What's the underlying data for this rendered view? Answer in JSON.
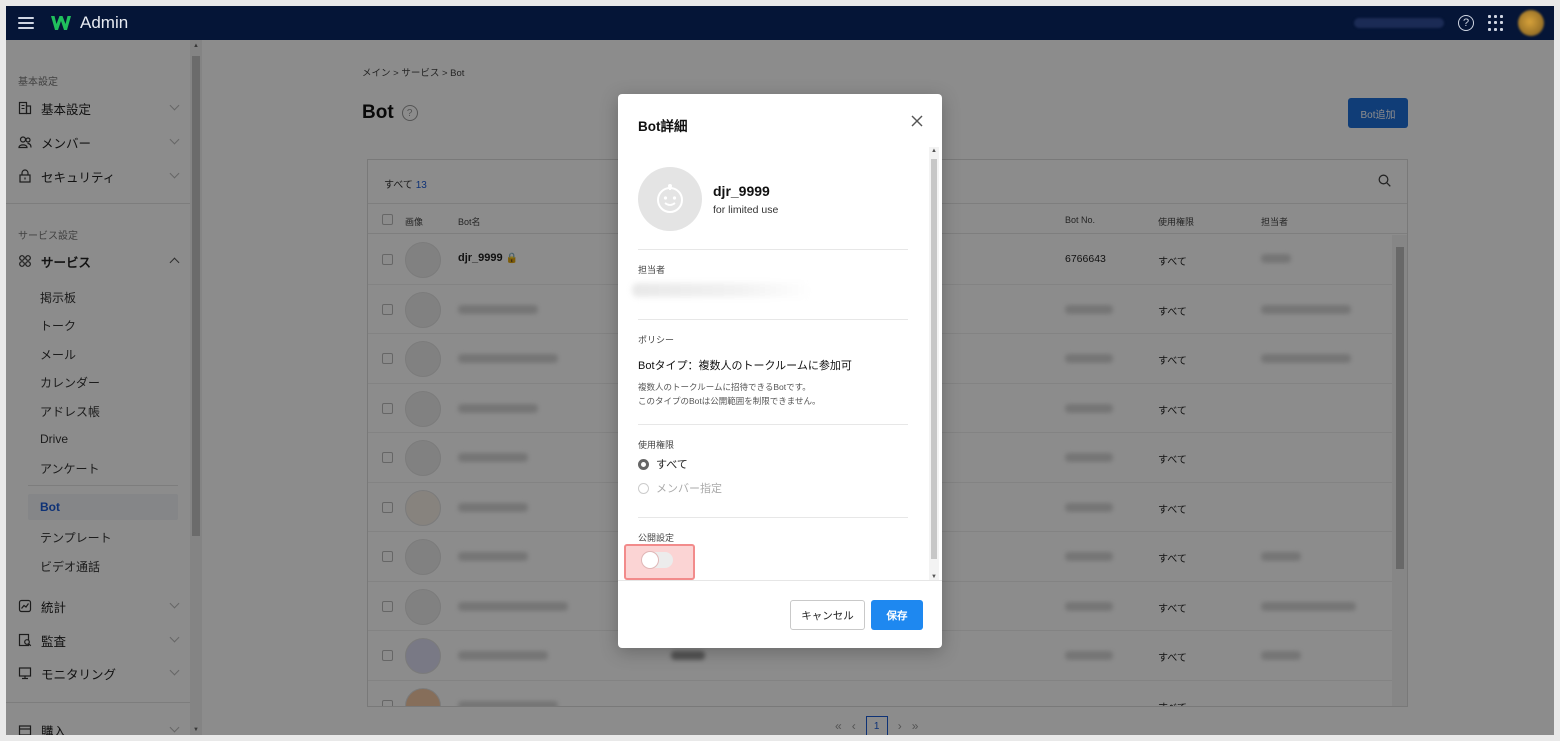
{
  "app": {
    "title": "Admin",
    "menu_icon": "hamburger-icon",
    "logo_icon": "w-logo-icon"
  },
  "topbar": {
    "help_icon": "help-icon",
    "apps_icon": "grid-icon",
    "avatar_icon": "user-avatar"
  },
  "sidebar": {
    "section_basic": "基本設定",
    "basic_items": [
      {
        "label": "基本設定",
        "icon": "building-icon"
      },
      {
        "label": "メンバー",
        "icon": "members-icon"
      },
      {
        "label": "セキュリティ",
        "icon": "lock-icon"
      }
    ],
    "section_service": "サービス設定",
    "service": {
      "label": "サービス",
      "icon": "services-icon"
    },
    "service_subitems": [
      "掲示板",
      "トーク",
      "メール",
      "カレンダー",
      "アドレス帳",
      "Drive",
      "アンケート"
    ],
    "service_subitems_2": [
      "Bot",
      "テンプレート",
      "ビデオ通話"
    ],
    "active_item": "Bot",
    "other_items": [
      {
        "label": "統計",
        "icon": "chart-icon"
      },
      {
        "label": "監査",
        "icon": "audit-icon"
      },
      {
        "label": "モニタリング",
        "icon": "monitor-icon"
      }
    ],
    "purchase": {
      "label": "購入",
      "icon": "wallet-icon"
    }
  },
  "page": {
    "breadcrumb": "メイン > サービス > Bot",
    "title": "Bot",
    "add_button": "Bot追加",
    "filter_all": "すべて",
    "filter_count": "13",
    "columns": {
      "image": "画像",
      "name": "Bot名",
      "bot_no": "Bot No.",
      "permission": "使用権限",
      "owner": "担当者"
    },
    "rows": [
      {
        "name": "djr_9999",
        "bot_no": "6766643",
        "permission": "すべて"
      },
      {
        "permission": "すべて"
      },
      {
        "permission": "すべて"
      },
      {
        "permission": "すべて"
      },
      {
        "permission": "すべて"
      },
      {
        "permission": "すべて"
      },
      {
        "permission": "すべて"
      },
      {
        "permission": "すべて"
      },
      {
        "permission": "すべて"
      },
      {
        "permission": "すべて"
      }
    ],
    "pager": {
      "first": "«",
      "prev": "‹",
      "current": "1",
      "next": "›",
      "last": "»"
    }
  },
  "modal": {
    "title": "Bot詳細",
    "bot_name": "djr_9999",
    "bot_description": "for limited use",
    "owner_label": "担当者",
    "policy_label": "ポリシー",
    "policy_value": "Botタイプ：複数人のトークルームに参加可",
    "policy_note_1": "複数人のトークルームに招待できるBotです。",
    "policy_note_2": "このタイプのBotは公開範囲を制限できません。",
    "permission_label": "使用権限",
    "permission_options": [
      "すべて",
      "メンバー指定"
    ],
    "permission_selected": "すべて",
    "publish_label": "公開設定",
    "publish_enabled": false,
    "cancel_button": "キャンセル",
    "save_button": "保存"
  }
}
